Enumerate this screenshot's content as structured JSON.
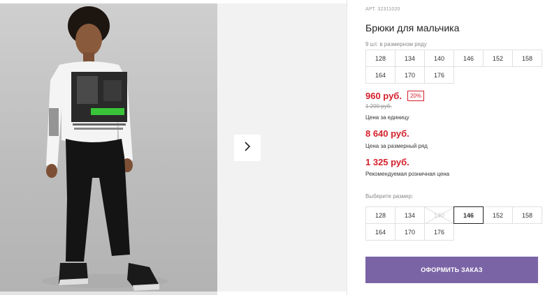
{
  "product": {
    "article": "АРТ. 32311020",
    "title": "Брюки для мальчика",
    "pack_note": "9 шт. в размерном ряду",
    "pack_sizes": [
      "128",
      "134",
      "140",
      "146",
      "152",
      "158",
      "164",
      "170",
      "176"
    ],
    "price": "960 руб.",
    "discount": "20%",
    "old_price": "1 200 руб.",
    "unit_price_label": "Цена за единицу",
    "range_price": "8 640 руб.",
    "range_price_label": "Цена за размерный ряд",
    "retail_price": "1 325 руб.",
    "retail_price_label": "Рекомендуемая розничная цена",
    "choose_size_label": "Выберите размер:",
    "selectable_sizes": [
      "128",
      "134",
      "140",
      "146",
      "152",
      "158",
      "164",
      "170",
      "176"
    ],
    "selected_size": "146",
    "disabled_size": "140",
    "order_button": "ОФОРМИТЬ ЗАКАЗ"
  },
  "gallery": {
    "next_icon": "chevron-right-icon"
  },
  "colors": {
    "price_red": "#d4202b",
    "order_button_bg": "#7b64a6",
    "photo_bg": "#c4c4c4",
    "panel_bg": "#f2f2f2"
  }
}
